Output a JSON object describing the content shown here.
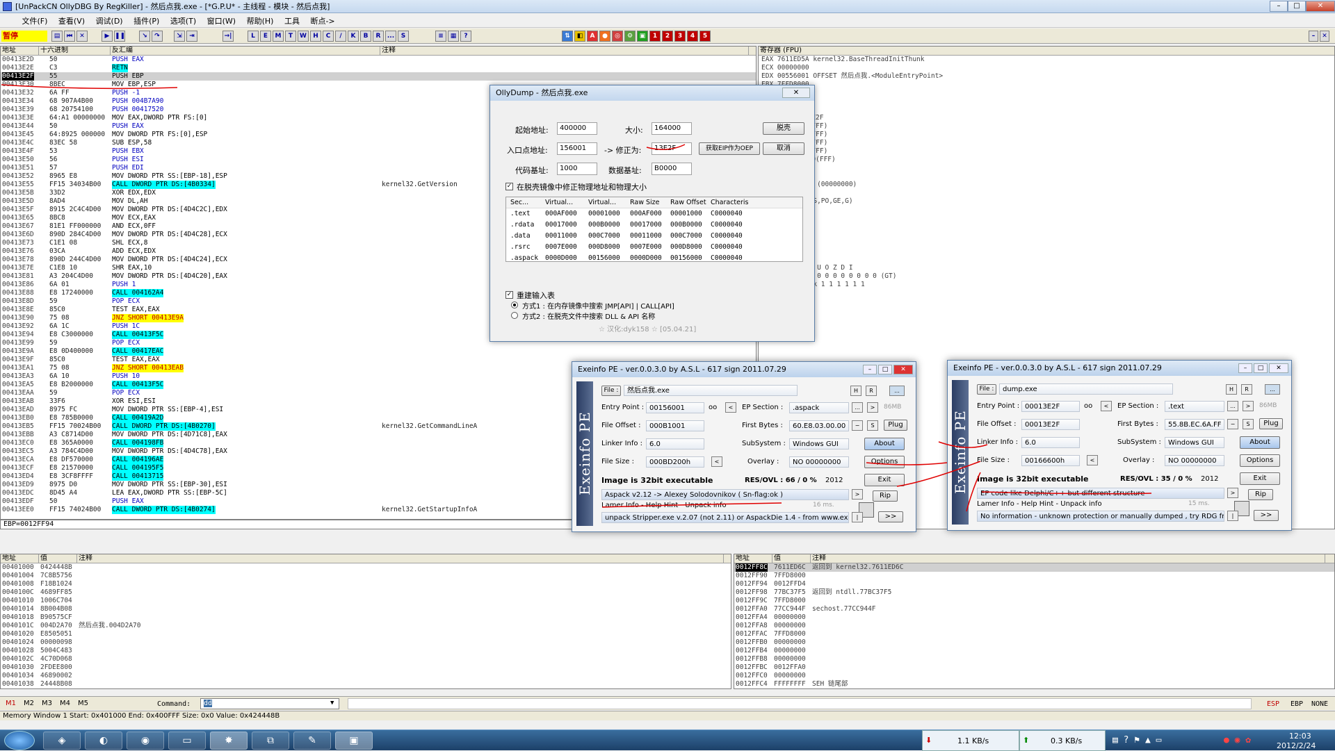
{
  "window": {
    "title": "[UnPackCN OllyDBG By RegKiller] - 然后点我.exe - [*G.P.U* - 主线程 - 模块 - 然后点我]"
  },
  "menu": [
    "文件(F)",
    "查看(V)",
    "调试(D)",
    "插件(P)",
    "选项(T)",
    "窗口(W)",
    "帮助(H)",
    "工具",
    "断点->"
  ],
  "toolbar": {
    "status": "暂停",
    "letters": [
      "L",
      "E",
      "M",
      "T",
      "W",
      "H",
      "C",
      "/",
      "K",
      "B",
      "R",
      "...",
      "S"
    ]
  },
  "disasm": {
    "headers": [
      "地址",
      "十六进制",
      "反汇编",
      "注释"
    ],
    "rows": [
      {
        "a": "00413E2D",
        "h": "50",
        "i": "PUSH EAX",
        "c": "",
        "s": "blue"
      },
      {
        "a": "00413E2E",
        "h": "C3",
        "i": "RETN",
        "c": "",
        "s": "cyan"
      },
      {
        "a": "00413E2F",
        "h": "55",
        "i": "PUSH EBP",
        "c": "",
        "s": "sel"
      },
      {
        "a": "00413E30",
        "h": "8BEC",
        "i": "MOV EBP,ESP",
        "c": "",
        "s": ""
      },
      {
        "a": "00413E32",
        "h": "6A FF",
        "i": "PUSH -1",
        "c": "",
        "s": "blue"
      },
      {
        "a": "00413E34",
        "h": "68 907A4B00",
        "i": "PUSH 004B7A90",
        "c": "",
        "s": "blue"
      },
      {
        "a": "00413E39",
        "h": "68 20754100",
        "i": "PUSH 00417520",
        "c": "",
        "s": "blue"
      },
      {
        "a": "00413E3E",
        "h": "64:A1 00000000",
        "i": "MOV EAX,DWORD PTR FS:[0]",
        "c": "",
        "s": ""
      },
      {
        "a": "00413E44",
        "h": "50",
        "i": "PUSH EAX",
        "c": "",
        "s": "blue"
      },
      {
        "a": "00413E45",
        "h": "64:8925 000000",
        "i": "MOV DWORD PTR FS:[0],ESP",
        "c": "",
        "s": ""
      },
      {
        "a": "00413E4C",
        "h": "83EC 58",
        "i": "SUB ESP,58",
        "c": "",
        "s": ""
      },
      {
        "a": "00413E4F",
        "h": "53",
        "i": "PUSH EBX",
        "c": "",
        "s": "blue"
      },
      {
        "a": "00413E50",
        "h": "56",
        "i": "PUSH ESI",
        "c": "",
        "s": "blue"
      },
      {
        "a": "00413E51",
        "h": "57",
        "i": "PUSH EDI",
        "c": "",
        "s": "blue"
      },
      {
        "a": "00413E52",
        "h": "8965 E8",
        "i": "MOV DWORD PTR SS:[EBP-18],ESP",
        "c": "",
        "s": ""
      },
      {
        "a": "00413E55",
        "h": "FF15 34034B00",
        "i": "CALL DWORD PTR DS:[4B0334]",
        "c": "kernel32.GetVersion",
        "s": "cyan"
      },
      {
        "a": "00413E5B",
        "h": "33D2",
        "i": "XOR EDX,EDX",
        "c": "",
        "s": ""
      },
      {
        "a": "00413E5D",
        "h": "8AD4",
        "i": "MOV DL,AH",
        "c": "",
        "s": ""
      },
      {
        "a": "00413E5F",
        "h": "8915 2C4C4D00",
        "i": "MOV DWORD PTR DS:[4D4C2C],EDX",
        "c": "",
        "s": ""
      },
      {
        "a": "00413E65",
        "h": "8BC8",
        "i": "MOV ECX,EAX",
        "c": "",
        "s": ""
      },
      {
        "a": "00413E67",
        "h": "81E1 FF000000",
        "i": "AND ECX,0FF",
        "c": "",
        "s": ""
      },
      {
        "a": "00413E6D",
        "h": "890D 284C4D00",
        "i": "MOV DWORD PTR DS:[4D4C28],ECX",
        "c": "",
        "s": ""
      },
      {
        "a": "00413E73",
        "h": "C1E1 08",
        "i": "SHL ECX,8",
        "c": "",
        "s": ""
      },
      {
        "a": "00413E76",
        "h": "03CA",
        "i": "ADD ECX,EDX",
        "c": "",
        "s": ""
      },
      {
        "a": "00413E78",
        "h": "890D 244C4D00",
        "i": "MOV DWORD PTR DS:[4D4C24],ECX",
        "c": "",
        "s": ""
      },
      {
        "a": "00413E7E",
        "h": "C1E8 10",
        "i": "SHR EAX,10",
        "c": "",
        "s": ""
      },
      {
        "a": "00413E81",
        "h": "A3 204C4D00",
        "i": "MOV DWORD PTR DS:[4D4C20],EAX",
        "c": "",
        "s": ""
      },
      {
        "a": "00413E86",
        "h": "6A 01",
        "i": "PUSH 1",
        "c": "",
        "s": "blue"
      },
      {
        "a": "00413E88",
        "h": "E8 17240000",
        "i": "CALL 004162A4",
        "c": "",
        "s": "cyan"
      },
      {
        "a": "00413E8D",
        "h": "59",
        "i": "POP ECX",
        "c": "",
        "s": "blue"
      },
      {
        "a": "00413E8E",
        "h": "85C0",
        "i": "TEST EAX,EAX",
        "c": "",
        "s": ""
      },
      {
        "a": "00413E90",
        "h": "75 08",
        "i": "JNZ SHORT 00413E9A",
        "c": "",
        "s": "yellow"
      },
      {
        "a": "00413E92",
        "h": "6A 1C",
        "i": "PUSH 1C",
        "c": "",
        "s": "blue"
      },
      {
        "a": "00413E94",
        "h": "E8 C3000000",
        "i": "CALL 00413F5C",
        "c": "",
        "s": "cyan"
      },
      {
        "a": "00413E99",
        "h": "59",
        "i": "POP ECX",
        "c": "",
        "s": "blue"
      },
      {
        "a": "00413E9A",
        "h": "E8 0D400000",
        "i": "CALL 00417EAC",
        "c": "",
        "s": "cyan"
      },
      {
        "a": "00413E9F",
        "h": "85C0",
        "i": "TEST EAX,EAX",
        "c": "",
        "s": ""
      },
      {
        "a": "00413EA1",
        "h": "75 08",
        "i": "JNZ SHORT 00413EAB",
        "c": "",
        "s": "yellow"
      },
      {
        "a": "00413EA3",
        "h": "6A 10",
        "i": "PUSH 10",
        "c": "",
        "s": "blue"
      },
      {
        "a": "00413EA5",
        "h": "E8 B2000000",
        "i": "CALL 00413F5C",
        "c": "",
        "s": "cyan"
      },
      {
        "a": "00413EAA",
        "h": "59",
        "i": "POP ECX",
        "c": "",
        "s": "blue"
      },
      {
        "a": "00413EAB",
        "h": "33F6",
        "i": "XOR ESI,ESI",
        "c": "",
        "s": ""
      },
      {
        "a": "00413EAD",
        "h": "8975 FC",
        "i": "MOV DWORD PTR SS:[EBP-4],ESI",
        "c": "",
        "s": ""
      },
      {
        "a": "00413EB0",
        "h": "E8 785B0000",
        "i": "CALL 00419A2D",
        "c": "",
        "s": "cyan"
      },
      {
        "a": "00413EB5",
        "h": "FF15 70024B00",
        "i": "CALL DWORD PTR DS:[4B0270]",
        "c": "kernel32.GetCommandLineA",
        "s": "cyan"
      },
      {
        "a": "00413EBB",
        "h": "A3 C8714D00",
        "i": "MOV DWORD PTR DS:[4D71C8],EAX",
        "c": "",
        "s": ""
      },
      {
        "a": "00413EC0",
        "h": "E8 365A0000",
        "i": "CALL 004198FB",
        "c": "",
        "s": "cyan"
      },
      {
        "a": "00413EC5",
        "h": "A3 784C4D00",
        "i": "MOV DWORD PTR DS:[4D4C78],EAX",
        "c": "",
        "s": ""
      },
      {
        "a": "00413ECA",
        "h": "E8 DF570000",
        "i": "CALL 004196AE",
        "c": "",
        "s": "cyan"
      },
      {
        "a": "00413ECF",
        "h": "E8 21570000",
        "i": "CALL 004195F5",
        "c": "",
        "s": "cyan"
      },
      {
        "a": "00413ED4",
        "h": "E8 3CF8FFFF",
        "i": "CALL 00413715",
        "c": "",
        "s": "cyan"
      },
      {
        "a": "00413ED9",
        "h": "8975 D0",
        "i": "MOV DWORD PTR SS:[EBP-30],ESI",
        "c": "",
        "s": ""
      },
      {
        "a": "00413EDC",
        "h": "8D45 A4",
        "i": "LEA EAX,DWORD PTR SS:[EBP-5C]",
        "c": "",
        "s": ""
      },
      {
        "a": "00413EDF",
        "h": "50",
        "i": "PUSH EAX",
        "c": "",
        "s": "blue"
      },
      {
        "a": "00413EE0",
        "h": "FF15 74024B00",
        "i": "CALL DWORD PTR DS:[4B0274]",
        "c": "kernel32.GetStartupInfoA",
        "s": "cyan"
      }
    ],
    "info_line": "EBP=0012FF94"
  },
  "registers": {
    "header": "寄存器 (FPU)",
    "lines": [
      "EAX 7611ED5A kernel32.BaseThreadInitThunk",
      "ECX 00000000",
      "EDX 00556001 OFFSET 然后点我.<ModuleEntryPoint>",
      "EBX 7FFD8000",
      "",
      "",
      "",
      "然后点我.00413E2F",
      "32 位 0(FFFFFFFF)",
      "32 位 0(FFFFFFFF)",
      "32 位 0(FFFFFFFF)",
      "32 位 0(FFFFFFFF)",
      "32 位 7FFDF000(FFF)",
      "NULL",
      "",
      "ERROR_SUCCESS (00000000)",
      "",
      "(NO,NB,NE,A,NS,PO,GE,G)",
      "",
      "",
      "",
      "",
      "",
      "",
      "",
      "3 2 1 0      E S P U O Z D I",
      "d 0 0 0 0   Err 0 0 0 0 0 0 0 0  (GT)",
      "c NEAR,53  Mask    1 1 1 1 1 1"
    ]
  },
  "dump": {
    "headers": [
      "地址",
      "值",
      "注释"
    ],
    "rows": [
      {
        "a": "00401000",
        "v": "0424448B",
        "c": ""
      },
      {
        "a": "00401004",
        "v": "7C8B5756",
        "c": ""
      },
      {
        "a": "00401008",
        "v": "F18B1024",
        "c": ""
      },
      {
        "a": "0040100C",
        "v": "4689FF85",
        "c": ""
      },
      {
        "a": "00401010",
        "v": "1006C704",
        "c": ""
      },
      {
        "a": "00401014",
        "v": "8B004B08",
        "c": ""
      },
      {
        "a": "00401018",
        "v": "B90575CF",
        "c": ""
      },
      {
        "a": "0040101C",
        "v": "004D2A70",
        "c": "然后点我.004D2A70"
      },
      {
        "a": "00401020",
        "v": "E8505051",
        "c": ""
      },
      {
        "a": "00401024",
        "v": "00000098",
        "c": ""
      },
      {
        "a": "00401028",
        "v": "5004C483",
        "c": ""
      },
      {
        "a": "0040102C",
        "v": "4C70D068",
        "c": ""
      },
      {
        "a": "00401030",
        "v": "2FDEE800",
        "c": ""
      },
      {
        "a": "00401034",
        "v": "46890002",
        "c": ""
      },
      {
        "a": "00401038",
        "v": "24448B08",
        "c": ""
      }
    ]
  },
  "stack": {
    "headers": [
      "地址",
      "值",
      "注释"
    ],
    "rows": [
      {
        "a": "0012FF8C",
        "v": "7611ED6C",
        "c": "返回到 kernel32.7611ED6C",
        "sel": true
      },
      {
        "a": "0012FF90",
        "v": "7FFD8000",
        "c": ""
      },
      {
        "a": "0012FF94",
        "v": "0012FFD4",
        "c": ""
      },
      {
        "a": "0012FF98",
        "v": "77BC37F5",
        "c": "返回到 ntdll.77BC37F5"
      },
      {
        "a": "0012FF9C",
        "v": "7FFD8000",
        "c": ""
      },
      {
        "a": "0012FFA0",
        "v": "77CC944F",
        "c": "sechost.77CC944F"
      },
      {
        "a": "0012FFA4",
        "v": "00000000",
        "c": ""
      },
      {
        "a": "0012FFA8",
        "v": "00000000",
        "c": ""
      },
      {
        "a": "0012FFAC",
        "v": "7FFD8000",
        "c": ""
      },
      {
        "a": "0012FFB0",
        "v": "00000000",
        "c": ""
      },
      {
        "a": "0012FFB4",
        "v": "00000000",
        "c": ""
      },
      {
        "a": "0012FFB8",
        "v": "00000000",
        "c": ""
      },
      {
        "a": "0012FFBC",
        "v": "0012FFA0",
        "c": ""
      },
      {
        "a": "0012FFC0",
        "v": "00000000",
        "c": ""
      },
      {
        "a": "0012FFC4",
        "v": "FFFFFFFF",
        "c": "SEH 链尾部"
      }
    ]
  },
  "command": {
    "tabs": [
      "M1",
      "M2",
      "M3",
      "M4",
      "M5"
    ],
    "label": "Command:",
    "value": "dd",
    "flags": [
      "ESP",
      "EBP",
      "NONE"
    ]
  },
  "status_line": "Memory Window 1 Start: 0x401000  End: 0x400FFF  Size: 0x0  Value: 0x424448B",
  "ollydump": {
    "title": "OllyDump - 然后点我.exe",
    "start_label": "起始地址:",
    "start": "400000",
    "size_label": "大小:",
    "size": "164000",
    "dump_button": "脱壳",
    "ep_label": "入口点地址:",
    "ep": "156001",
    "fix_label": "-> 修正为:",
    "fix": "13E2F",
    "eip_button": "获取EIP作为OEP",
    "cancel_button": "取消",
    "code_label": "代码基址:",
    "code": "1000",
    "data_label": "数据基址:",
    "data": "B0000",
    "fix_check": "在脱壳镜像中修正物理地址和物理大小",
    "sect_headers": [
      "Sec...",
      "Virtual...",
      "Virtual...",
      "Raw Size",
      "Raw Offset",
      "Characteris"
    ],
    "sections": [
      [
        ".text",
        "000AF000",
        "00001000",
        "000AF000",
        "00001000",
        "C0000040"
      ],
      [
        ".rdata",
        "00017000",
        "000B0000",
        "00017000",
        "000B0000",
        "C0000040"
      ],
      [
        ".data",
        "00011000",
        "000C7000",
        "00011000",
        "000C7000",
        "C0000040"
      ],
      [
        ".rsrc",
        "0007E000",
        "000D8000",
        "0007E000",
        "000D8000",
        "C0000040"
      ],
      [
        ".aspack",
        "0000D000",
        "00156000",
        "0000D000",
        "00156000",
        "C0000040"
      ]
    ],
    "rebuild_check": "重建输入表",
    "method1": "方式1 : 在内存镜像中搜索 JMP[API] | CALL[API]",
    "method2": "方式2 : 在脱壳文件中搜索 DLL & API 名称",
    "credit": "☆ 汉化:dyk158 ☆ [05.04.21]"
  },
  "exeinfo_left": {
    "title": "Exeinfo PE - ver.0.0.3.0  by A.S.L - 617 sign 2011.07.29",
    "side": "Exeinfo PE",
    "file_btn": "File :",
    "file": "然后点我.exe",
    "ep_label": "Entry Point :",
    "ep": "00156001",
    "oo": "oo",
    "eps_label": "EP Section :",
    "eps": ".aspack",
    "fo_label": "File Offset :",
    "fo": "000B1001",
    "fb_label": "First Bytes :",
    "fb": "60.E8.03.00.00",
    "li_label": "Linker Info :",
    "li": "6.0",
    "ss_label": "SubSystem :",
    "ss": "Windows GUI",
    "fs_label": "File Size :",
    "fs": "000BD200h",
    "ov_label": "Overlay :",
    "ov": "NO  00000000",
    "img": "Image is 32bit executable",
    "res": "RES/OVL : 66 / 0 %",
    "year": "2012",
    "detect": "Aspack v2.12 -> Alexey Solodovnikov ( Sn-flag:ok )",
    "lamer": "Lamer Info - Help Hint - Unpack info",
    "ms": "16 ms.",
    "unpack": "unpack Stripper.exe v.2.07 (not 2.11) or AspackDie 1.4 - from www.ex",
    "about": "About",
    "options": "Options",
    "exit": "Exit",
    "rip": "Rip",
    "plug": "Plug",
    "mb": "86MB",
    "h": "H",
    "r": "R",
    "s": "S",
    "next": ">>",
    "more": "..."
  },
  "exeinfo_right": {
    "title": "Exeinfo PE - ver.0.0.3.0  by A.S.L - 617 sign 2011.07.29",
    "side": "Exeinfo PE",
    "file_btn": "File :",
    "file": "dump.exe",
    "ep_label": "Entry Point :",
    "ep": "00013E2F",
    "oo": "oo",
    "eps_label": "EP Section :",
    "eps": ".text",
    "fo_label": "File Offset :",
    "fo": "00013E2F",
    "fb_label": "First Bytes :",
    "fb": "55.8B.EC.6A.FF",
    "li_label": "Linker Info :",
    "li": "6.0",
    "ss_label": "SubSystem :",
    "ss": "Windows GUI",
    "fs_label": "File Size :",
    "fs": "00166600h",
    "ov_label": "Overlay :",
    "ov": "NO  00000000",
    "img": "Image is 32bit executable",
    "res": "RES/OVL : 35 / 0 %",
    "year": "2012",
    "detect": "EP code like Delphi/C++ but different structure",
    "lamer": "Lamer Info - Help Hint - Unpack info",
    "ms": "15 ms.",
    "unpack": "No information - unknown protection or manually dumped , try RDG fro",
    "about": "About",
    "options": "Options",
    "exit": "Exit",
    "rip": "Rip",
    "plug": "Plug",
    "mb": "86MB",
    "h": "H",
    "r": "R",
    "s": "S",
    "next": ">>",
    "more": "..."
  },
  "taskbar": {
    "down": "1.1 KB/s",
    "up": "0.3 KB/s",
    "time": "12:03",
    "date": "2012/2/24"
  }
}
